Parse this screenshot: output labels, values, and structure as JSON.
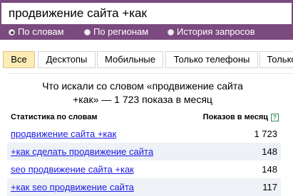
{
  "search": {
    "query": "продвижение сайта +как"
  },
  "filters": [
    {
      "label": "По словам",
      "checked": true
    },
    {
      "label": "По регионам",
      "checked": false
    },
    {
      "label": "История запросов",
      "checked": false
    }
  ],
  "tabs": [
    {
      "label": "Все",
      "active": true
    },
    {
      "label": "Десктопы",
      "active": false
    },
    {
      "label": "Мобильные",
      "active": false
    },
    {
      "label": "Только телефоны",
      "active": false
    },
    {
      "label": "Только",
      "active": false
    }
  ],
  "panel": {
    "title_line1": "Что искали со словом «продвижение сайта",
    "title_line2": "+как» — 1 723 показа в месяц",
    "col_words": "Статистика по словам",
    "col_shows": "Показов в месяц",
    "help_glyph": "?",
    "rows": [
      {
        "phrase": "продвижение сайта +как",
        "count": "1 723"
      },
      {
        "phrase": "+как сделать продвижение сайта",
        "count": "148"
      },
      {
        "phrase": "seo продвижение сайта +как",
        "count": "148"
      },
      {
        "phrase": "+как seo продвижение сайта",
        "count": "117"
      }
    ]
  },
  "colors": {
    "header_bg": "#7b4a7f",
    "active_tab_bg": "#fdecb3",
    "link": "#1a1ae6",
    "alt_row_bg": "#eef1f6"
  }
}
